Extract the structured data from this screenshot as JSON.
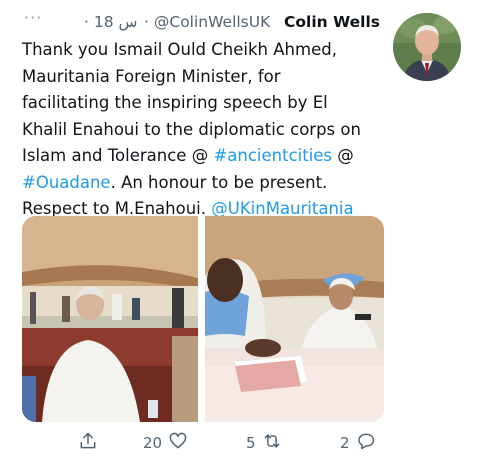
{
  "tweet": {
    "more_label": "···",
    "time": "18 س",
    "separator": "·",
    "handle": "@ColinWellsUK",
    "author_name": "Colin Wells",
    "text_parts": {
      "p1": "Thank you Ismail Ould Cheikh Ahmed,\nMauritania Foreign Minister, for\nfacilitating the inspiring speech by El\nKhalil Enahoui to the diplomatic corps on\nIslam and Tolerance @ ",
      "hashtag1": "#ancientcities",
      "p2": " @\n",
      "hashtag2": "#Ouadane",
      "p3": ". An honour to be present.\nRespect to M.Enahoui. ",
      "mention": "@UKinMauritania"
    },
    "link_color": "#1d9bf0"
  },
  "actions": {
    "share_icon": "share-icon",
    "likes_count": "20",
    "like_icon": "heart-icon",
    "retweets_count": "5",
    "retweet_icon": "retweet-icon",
    "replies_count": "2",
    "reply_icon": "reply-icon"
  }
}
